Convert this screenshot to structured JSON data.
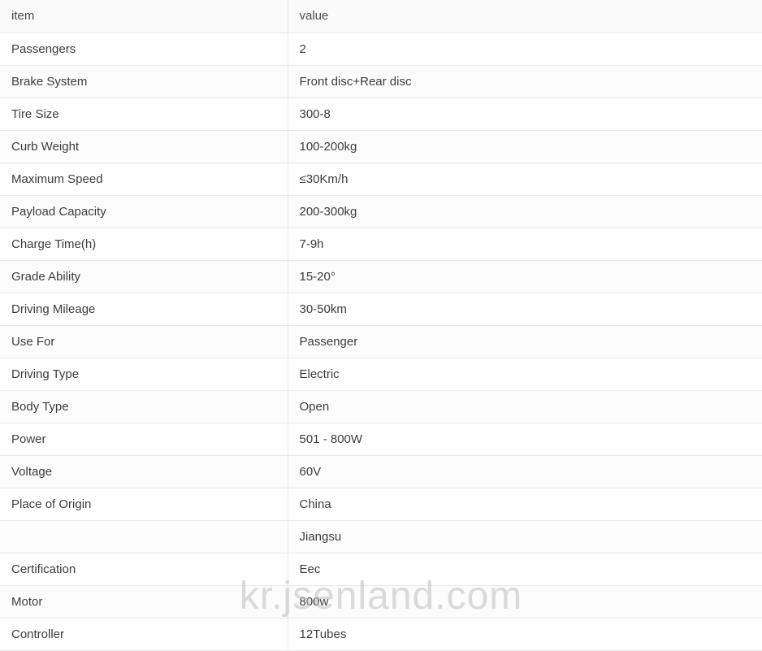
{
  "table": {
    "columns": [
      "item",
      "value"
    ],
    "rows": [
      [
        "Passengers",
        "2"
      ],
      [
        "Brake System",
        "Front disc+Rear disc"
      ],
      [
        "Tire Size",
        "300-8"
      ],
      [
        "Curb Weight",
        "100-200kg"
      ],
      [
        "Maximum Speed",
        "≤30Km/h"
      ],
      [
        "Payload Capacity",
        "200-300kg"
      ],
      [
        "Charge Time(h)",
        "7-9h"
      ],
      [
        "Grade Ability",
        "15-20°"
      ],
      [
        "Driving Mileage",
        "30-50km"
      ],
      [
        "Use For",
        "Passenger"
      ],
      [
        "Driving Type",
        "Electric"
      ],
      [
        "Body Type",
        "Open"
      ],
      [
        "Power",
        "501 - 800W"
      ],
      [
        "Voltage",
        "60V"
      ],
      [
        "Place of Origin",
        "China"
      ],
      [
        "",
        "Jiangsu"
      ],
      [
        "Certification",
        "Eec"
      ],
      [
        "Motor",
        "800w"
      ],
      [
        "Controller",
        "12Tubes"
      ]
    ]
  },
  "watermark": {
    "text": "kr.jsenland.com"
  }
}
